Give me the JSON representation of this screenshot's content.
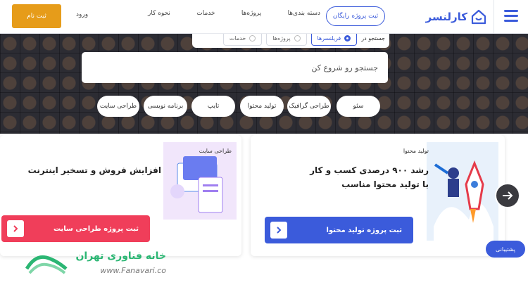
{
  "header": {
    "logo_text": "کارلنسر",
    "free_project_label": "ثبت پروژه رایگان",
    "nav": [
      "دسته بندی‌ها",
      "پروژه‌ها",
      "خدمات",
      "نحوه کار"
    ],
    "login_label": "ورود",
    "signup_label": "ثبت نام"
  },
  "search": {
    "search_in_label": "جستجو در",
    "options": [
      {
        "label": "فریلنسرها",
        "selected": true
      },
      {
        "label": "پروژه‌ها",
        "selected": false
      },
      {
        "label": "خدمات",
        "selected": false
      }
    ],
    "placeholder": "جستجو رو شروع کن"
  },
  "tags": [
    "سئو",
    "طراحی گرافیک",
    "تولید محتوا",
    "تایپ",
    "برنامه نویسی",
    "طراحی سایت"
  ],
  "cards": [
    {
      "category": "تولید محتوا",
      "title": "رشد ۹۰۰ درصدی کسب و کار با تولید محتوا مناسب",
      "button": "ثبت پروژه تولید محتوا",
      "color": "#3b5bdb"
    },
    {
      "category": "طراحی سایت",
      "title": "افزایش فروش و تسخیر اینترنت",
      "button": "ثبت پروژه طراحی سایت",
      "color": "#f03e5a"
    }
  ],
  "support_label": "پشتیبانی",
  "watermark": {
    "title": "خانه فناوری تهران",
    "url": "www.Fanavari.co"
  },
  "colors": {
    "brand": "#3b5bdb",
    "signup": "#e69c1a",
    "accent_red": "#f03e5a"
  }
}
